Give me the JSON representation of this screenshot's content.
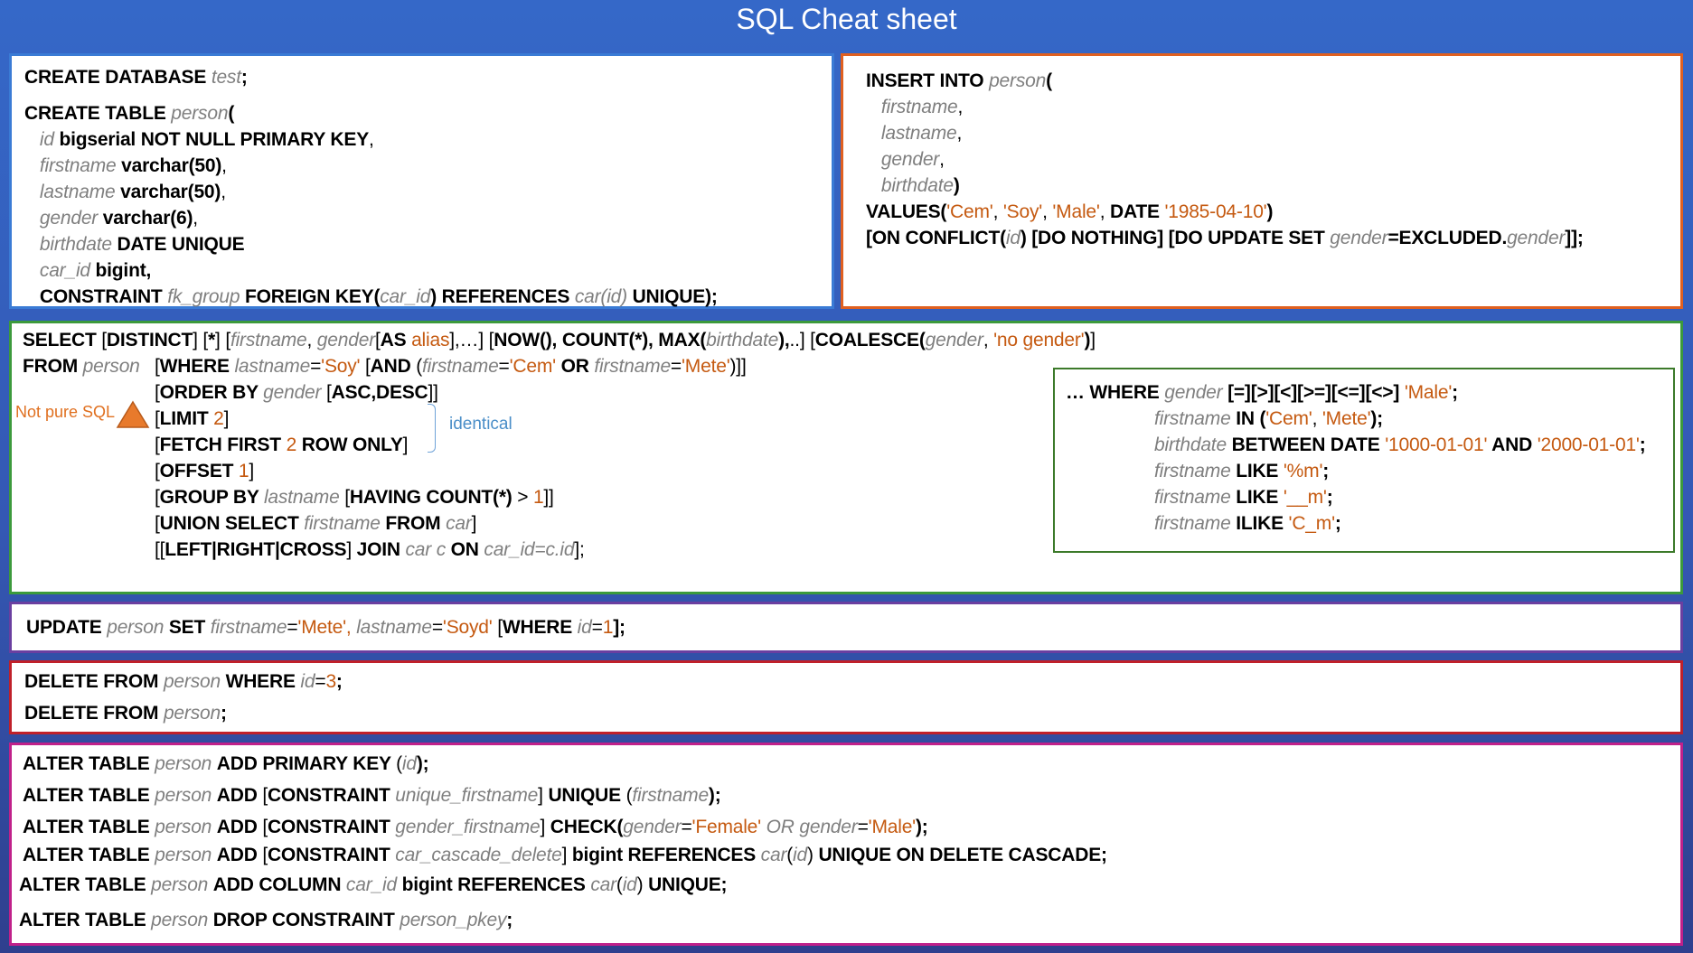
{
  "title": "SQL Cheat sheet",
  "colors": {
    "keyword": "#000000",
    "identifier": "#7f7f7f",
    "string": "#c55a11",
    "box_create": "#3a7bd5",
    "box_insert": "#e06020",
    "box_select": "#3c9a3c",
    "box_update": "#6a3fa0",
    "box_delete": "#c0202a",
    "box_alter": "#c0208a"
  },
  "create_box": {
    "lines": [
      [
        [
          "kw",
          "CREATE DATABASE "
        ],
        [
          "id",
          "test"
        ],
        [
          "p",
          ";"
        ]
      ],
      [
        [
          "kw",
          "CREATE TABLE "
        ],
        [
          "id",
          "person"
        ],
        [
          "p",
          "("
        ]
      ],
      [
        [
          "n",
          "   "
        ],
        [
          "id",
          "id "
        ],
        [
          "kw",
          "bigserial NOT NULL PRIMARY KEY"
        ],
        [
          "n",
          ","
        ]
      ],
      [
        [
          "n",
          "   "
        ],
        [
          "id",
          "firstname "
        ],
        [
          "kw",
          "varchar(50)"
        ],
        [
          "n",
          ","
        ]
      ],
      [
        [
          "n",
          "   "
        ],
        [
          "id",
          "lastname "
        ],
        [
          "kw",
          "varchar(50)"
        ],
        [
          "n",
          ","
        ]
      ],
      [
        [
          "n",
          "   "
        ],
        [
          "id",
          "gender "
        ],
        [
          "kw",
          "varchar(6)"
        ],
        [
          "n",
          ","
        ]
      ],
      [
        [
          "n",
          "   "
        ],
        [
          "id",
          "birthdate "
        ],
        [
          "kw",
          "DATE UNIQUE"
        ]
      ],
      [
        [
          "n",
          "   "
        ],
        [
          "id",
          "car_id "
        ],
        [
          "kw",
          "bigint,"
        ]
      ],
      [
        [
          "n",
          "   "
        ],
        [
          "kw",
          "CONSTRAINT "
        ],
        [
          "id",
          "fk_group "
        ],
        [
          "kw",
          "FOREIGN KEY("
        ],
        [
          "id",
          "car_id"
        ],
        [
          "kw",
          ") REFERENCES "
        ],
        [
          "id",
          "car(id) "
        ],
        [
          "kw",
          "UNIQUE);"
        ]
      ]
    ]
  },
  "insert_box": {
    "lines": [
      [
        [
          "kw",
          "INSERT INTO "
        ],
        [
          "id",
          "person"
        ],
        [
          "p",
          "("
        ]
      ],
      [
        [
          "n",
          "   "
        ],
        [
          "id",
          "firstname"
        ],
        [
          "n",
          ","
        ]
      ],
      [
        [
          "n",
          "   "
        ],
        [
          "id",
          "lastname"
        ],
        [
          "n",
          ","
        ]
      ],
      [
        [
          "n",
          "   "
        ],
        [
          "id",
          "gender"
        ],
        [
          "n",
          ","
        ]
      ],
      [
        [
          "n",
          "   "
        ],
        [
          "id",
          "birthdate"
        ],
        [
          "p",
          ")"
        ]
      ],
      [
        [
          "kw",
          "VALUES("
        ],
        [
          "str",
          "'Cem'"
        ],
        [
          "n",
          ", "
        ],
        [
          "str",
          "'Soy'"
        ],
        [
          "n",
          ", "
        ],
        [
          "str",
          "'Male'"
        ],
        [
          "n",
          ", "
        ],
        [
          "kw",
          "DATE "
        ],
        [
          "str",
          "'1985-04-10'"
        ],
        [
          "p",
          ")"
        ]
      ],
      [
        [
          "kw",
          "[ON CONFLICT("
        ],
        [
          "id",
          "id"
        ],
        [
          "kw",
          ") [DO NOTHING] [DO UPDATE SET "
        ],
        [
          "id",
          "gender"
        ],
        [
          "kw",
          "=EXCLUDED."
        ],
        [
          "id",
          "gender"
        ],
        [
          "kw",
          "]];"
        ]
      ]
    ]
  },
  "select_box": {
    "lines": [
      [
        [
          "kw",
          "SELECT "
        ],
        [
          "n",
          "["
        ],
        [
          "kw",
          "DISTINCT"
        ],
        [
          "n",
          "] ["
        ],
        [
          "kw",
          "*"
        ],
        [
          "n",
          "] ["
        ],
        [
          "id",
          "firstname"
        ],
        [
          "n",
          ", "
        ],
        [
          "id",
          "gender"
        ],
        [
          "n",
          "["
        ],
        [
          "kw",
          "AS "
        ],
        [
          "str",
          "alias"
        ],
        [
          "n",
          "],…] ["
        ],
        [
          "kw",
          "NOW(), COUNT(*), MAX("
        ],
        [
          "id",
          "birthdate"
        ],
        [
          "kw",
          "),"
        ],
        [
          "n",
          "..] ["
        ],
        [
          "kw",
          "COALESCE("
        ],
        [
          "id",
          "gender"
        ],
        [
          "n",
          ", "
        ],
        [
          "str",
          "'no gender'"
        ],
        [
          "kw",
          ")"
        ],
        [
          "n",
          "]"
        ]
      ],
      [
        [
          "kw",
          "FROM "
        ],
        [
          "id",
          "person"
        ]
      ],
      [
        [
          "n",
          "["
        ],
        [
          "kw",
          "WHERE "
        ],
        [
          "id",
          "lastname"
        ],
        [
          "n",
          "="
        ],
        [
          "str",
          "'Soy'"
        ],
        [
          "n",
          " ["
        ],
        [
          "kw",
          "AND "
        ],
        [
          "n",
          "("
        ],
        [
          "id",
          "firstname"
        ],
        [
          "n",
          "="
        ],
        [
          "str",
          "'Cem'"
        ],
        [
          "kw",
          " OR "
        ],
        [
          "id",
          "firstname"
        ],
        [
          "n",
          "="
        ],
        [
          "str",
          "'Mete'"
        ],
        [
          "n",
          ")]]"
        ]
      ],
      [
        [
          "n",
          "["
        ],
        [
          "kw",
          "ORDER BY "
        ],
        [
          "id",
          "gender "
        ],
        [
          "n",
          "["
        ],
        [
          "kw",
          "ASC,DESC"
        ],
        [
          "n",
          "]]"
        ]
      ],
      [
        [
          "n",
          "["
        ],
        [
          "kw",
          "LIMIT "
        ],
        [
          "str",
          "2"
        ],
        [
          "n",
          "]"
        ]
      ],
      [
        [
          "n",
          "["
        ],
        [
          "kw",
          "FETCH FIRST "
        ],
        [
          "str",
          "2"
        ],
        [
          "kw",
          " ROW ONLY"
        ],
        [
          "n",
          "]"
        ]
      ],
      [
        [
          "n",
          "["
        ],
        [
          "kw",
          "OFFSET "
        ],
        [
          "str",
          "1"
        ],
        [
          "n",
          "]"
        ]
      ],
      [
        [
          "n",
          "["
        ],
        [
          "kw",
          "GROUP BY "
        ],
        [
          "id",
          "lastname "
        ],
        [
          "n",
          "["
        ],
        [
          "kw",
          "HAVING COUNT(*) "
        ],
        [
          "n",
          "> "
        ],
        [
          "str",
          "1"
        ],
        [
          "n",
          "]]"
        ]
      ],
      [
        [
          "n",
          "["
        ],
        [
          "kw",
          "UNION SELECT "
        ],
        [
          "id",
          "firstname "
        ],
        [
          "kw",
          "FROM "
        ],
        [
          "id",
          "car"
        ],
        [
          "n",
          "]"
        ]
      ],
      [
        [
          "n",
          "[["
        ],
        [
          "kw",
          "LEFT|RIGHT|CROSS"
        ],
        [
          "n",
          "] "
        ],
        [
          "kw",
          "JOIN "
        ],
        [
          "id",
          "car c "
        ],
        [
          "kw",
          "ON "
        ],
        [
          "id",
          "car_id=c.id"
        ],
        [
          "n",
          "];"
        ]
      ]
    ],
    "note": "Not pure SQL",
    "identical_label": "identical"
  },
  "where_box": {
    "lines": [
      [
        [
          "kw",
          "… WHERE "
        ],
        [
          "id",
          "gender "
        ],
        [
          "kw",
          "[=][>][<][>=][<=][<>] "
        ],
        [
          "str",
          "'Male'"
        ],
        [
          "p",
          ";"
        ]
      ],
      [
        [
          "id",
          "firstname "
        ],
        [
          "kw",
          "IN ("
        ],
        [
          "str",
          "'Cem'"
        ],
        [
          "n",
          ", "
        ],
        [
          "str",
          "'Mete'"
        ],
        [
          "kw",
          ");"
        ]
      ],
      [
        [
          "id",
          "birthdate "
        ],
        [
          "kw",
          "BETWEEN DATE "
        ],
        [
          "str",
          "'1000-01-01'"
        ],
        [
          "kw",
          " AND "
        ],
        [
          "str",
          "'2000-01-01'"
        ],
        [
          "p",
          ";"
        ]
      ],
      [
        [
          "id",
          "firstname "
        ],
        [
          "kw",
          "LIKE "
        ],
        [
          "str",
          "'%m'"
        ],
        [
          "p",
          ";"
        ]
      ],
      [
        [
          "id",
          "firstname "
        ],
        [
          "kw",
          "LIKE "
        ],
        [
          "str",
          "'__m'"
        ],
        [
          "p",
          ";"
        ]
      ],
      [
        [
          "id",
          "firstname "
        ],
        [
          "kw",
          "ILIKE "
        ],
        [
          "str",
          "'C_m'"
        ],
        [
          "p",
          ";"
        ]
      ]
    ]
  },
  "update_box": {
    "lines": [
      [
        [
          "kw",
          "UPDATE "
        ],
        [
          "id",
          "person "
        ],
        [
          "kw",
          "SET "
        ],
        [
          "id",
          "firstname"
        ],
        [
          "n",
          "="
        ],
        [
          "str",
          "'Mete', "
        ],
        [
          "id",
          "lastname"
        ],
        [
          "n",
          "="
        ],
        [
          "str",
          "'Soyd'"
        ],
        [
          "n",
          " ["
        ],
        [
          "kw",
          "WHERE "
        ],
        [
          "id",
          "id"
        ],
        [
          "n",
          "="
        ],
        [
          "str",
          "1"
        ],
        [
          "kw",
          "];"
        ]
      ]
    ]
  },
  "delete_box": {
    "lines": [
      [
        [
          "kw",
          "DELETE FROM "
        ],
        [
          "id",
          "person "
        ],
        [
          "kw",
          "WHERE "
        ],
        [
          "id",
          "id"
        ],
        [
          "n",
          "="
        ],
        [
          "str",
          "3"
        ],
        [
          "p",
          ";"
        ]
      ],
      [
        [
          "kw",
          "DELETE FROM "
        ],
        [
          "id",
          "person"
        ],
        [
          "p",
          ";"
        ]
      ]
    ]
  },
  "alter_box": {
    "lines": [
      [
        [
          "kw",
          "ALTER TABLE "
        ],
        [
          "id",
          "person "
        ],
        [
          "kw",
          "ADD PRIMARY KEY "
        ],
        [
          "n",
          "("
        ],
        [
          "id",
          "id"
        ],
        [
          "kw",
          ");"
        ]
      ],
      [
        [
          "kw",
          "ALTER TABLE "
        ],
        [
          "id",
          "person "
        ],
        [
          "kw",
          "ADD "
        ],
        [
          "n",
          "["
        ],
        [
          "kw",
          "CONSTRAINT "
        ],
        [
          "id",
          "unique_firstname"
        ],
        [
          "n",
          "] "
        ],
        [
          "kw",
          "UNIQUE "
        ],
        [
          "n",
          "("
        ],
        [
          "id",
          "firstname"
        ],
        [
          "kw",
          ");"
        ]
      ],
      [
        [
          "kw",
          "ALTER TABLE "
        ],
        [
          "id",
          "person "
        ],
        [
          "kw",
          "ADD "
        ],
        [
          "n",
          "["
        ],
        [
          "kw",
          "CONSTRAINT "
        ],
        [
          "id",
          "gender_firstname"
        ],
        [
          "n",
          "] "
        ],
        [
          "kw",
          "CHECK("
        ],
        [
          "id",
          "gender"
        ],
        [
          "n",
          "="
        ],
        [
          "str",
          "'Female' "
        ],
        [
          "id",
          "OR "
        ],
        [
          "id",
          "gender"
        ],
        [
          "n",
          "="
        ],
        [
          "str",
          "'Male'"
        ],
        [
          "kw",
          ");"
        ]
      ],
      [
        [
          "kw",
          "ALTER TABLE "
        ],
        [
          "id",
          "person "
        ],
        [
          "kw",
          "ADD "
        ],
        [
          "n",
          "["
        ],
        [
          "kw",
          "CONSTRAINT "
        ],
        [
          "id",
          "car_cascade_delete"
        ],
        [
          "n",
          "] "
        ],
        [
          "kw",
          "bigint REFERENCES "
        ],
        [
          "id",
          "car"
        ],
        [
          "n",
          "("
        ],
        [
          "id",
          "id"
        ],
        [
          "n",
          ") "
        ],
        [
          "kw",
          "UNIQUE ON DELETE CASCADE;"
        ]
      ],
      [
        [
          "kw",
          "ALTER TABLE "
        ],
        [
          "id",
          "person "
        ],
        [
          "kw",
          "ADD COLUMN "
        ],
        [
          "id",
          "car_id "
        ],
        [
          "kw",
          "bigint REFERENCES "
        ],
        [
          "id",
          "car"
        ],
        [
          "n",
          "("
        ],
        [
          "id",
          "id"
        ],
        [
          "n",
          ") "
        ],
        [
          "kw",
          "UNIQUE;"
        ]
      ],
      [
        [
          "kw",
          "ALTER TABLE "
        ],
        [
          "id",
          "person "
        ],
        [
          "kw",
          "DROP CONSTRAINT "
        ],
        [
          "id",
          "person_pkey"
        ],
        [
          "p",
          ";"
        ]
      ]
    ]
  }
}
